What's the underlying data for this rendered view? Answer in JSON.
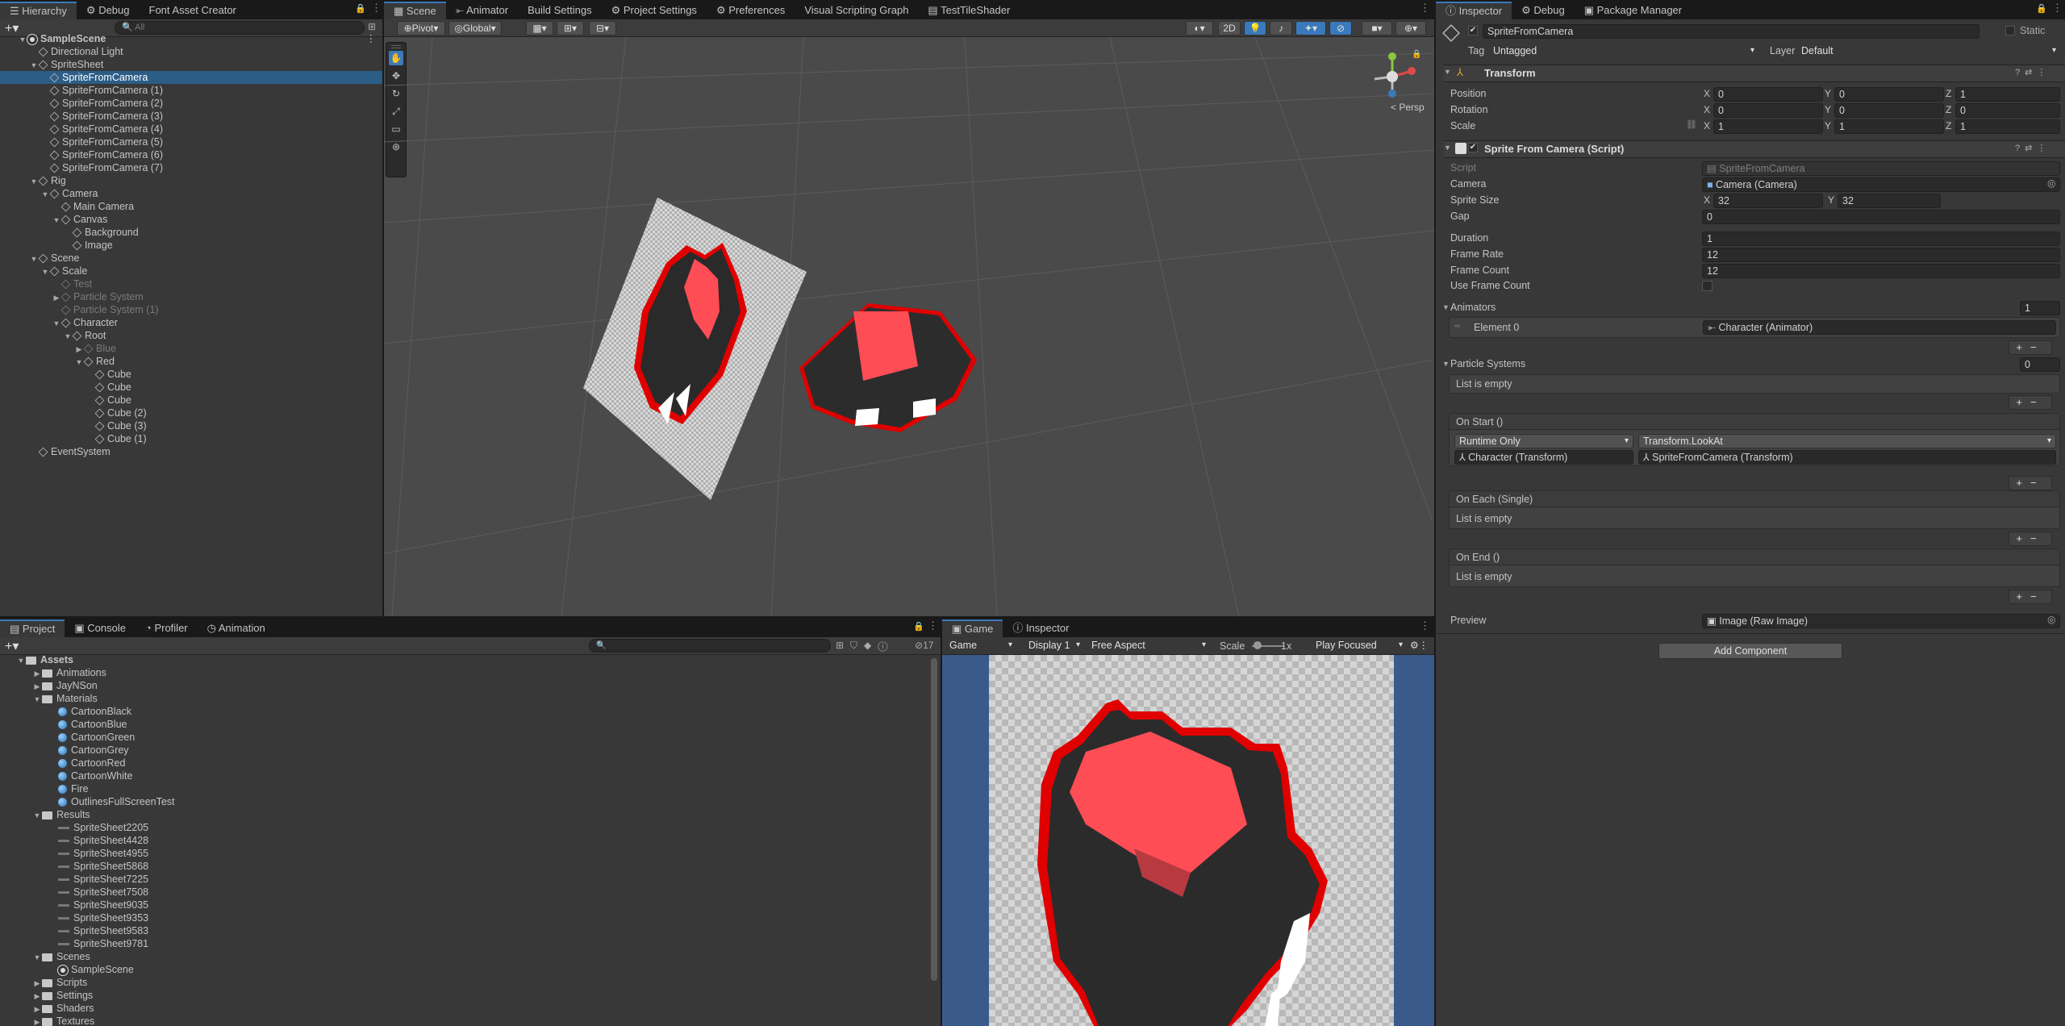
{
  "hierarchy": {
    "tabs": [
      "Hierarchy",
      "Debug",
      "Font Asset Creator"
    ],
    "search_placeholder": "All",
    "rows": [
      {
        "label": "SampleScene",
        "depth": 0,
        "arrow": "▼",
        "icon": "unity-scene-icon",
        "bold": true
      },
      {
        "label": "Directional Light",
        "depth": 1,
        "arrow": ""
      },
      {
        "label": "SpriteSheet",
        "depth": 1,
        "arrow": "▼"
      },
      {
        "label": "SpriteFromCamera",
        "depth": 2,
        "arrow": "",
        "selected": true
      },
      {
        "label": "SpriteFromCamera (1)",
        "depth": 2,
        "arrow": ""
      },
      {
        "label": "SpriteFromCamera (2)",
        "depth": 2,
        "arrow": ""
      },
      {
        "label": "SpriteFromCamera (3)",
        "depth": 2,
        "arrow": ""
      },
      {
        "label": "SpriteFromCamera (4)",
        "depth": 2,
        "arrow": ""
      },
      {
        "label": "SpriteFromCamera (5)",
        "depth": 2,
        "arrow": ""
      },
      {
        "label": "SpriteFromCamera (6)",
        "depth": 2,
        "arrow": ""
      },
      {
        "label": "SpriteFromCamera (7)",
        "depth": 2,
        "arrow": ""
      },
      {
        "label": "Rig",
        "depth": 1,
        "arrow": "▼"
      },
      {
        "label": "Camera",
        "depth": 2,
        "arrow": "▼"
      },
      {
        "label": "Main Camera",
        "depth": 3,
        "arrow": ""
      },
      {
        "label": "Canvas",
        "depth": 3,
        "arrow": "▼"
      },
      {
        "label": "Background",
        "depth": 4,
        "arrow": ""
      },
      {
        "label": "Image",
        "depth": 4,
        "arrow": ""
      },
      {
        "label": "Scene",
        "depth": 1,
        "arrow": "▼"
      },
      {
        "label": "Scale",
        "depth": 2,
        "arrow": "▼"
      },
      {
        "label": "Test",
        "depth": 3,
        "arrow": "",
        "dim": true
      },
      {
        "label": "Particle System",
        "depth": 3,
        "arrow": "▶",
        "dim": true
      },
      {
        "label": "Particle System (1)",
        "depth": 3,
        "arrow": "",
        "dim": true
      },
      {
        "label": "Character",
        "depth": 3,
        "arrow": "▼"
      },
      {
        "label": "Root",
        "depth": 4,
        "arrow": "▼"
      },
      {
        "label": "Blue",
        "depth": 5,
        "arrow": "▶",
        "dim": true
      },
      {
        "label": "Red",
        "depth": 5,
        "arrow": "▼"
      },
      {
        "label": "Cube",
        "depth": 6,
        "arrow": ""
      },
      {
        "label": "Cube",
        "depth": 6,
        "arrow": ""
      },
      {
        "label": "Cube",
        "depth": 6,
        "arrow": ""
      },
      {
        "label": "Cube (2)",
        "depth": 6,
        "arrow": ""
      },
      {
        "label": "Cube (3)",
        "depth": 6,
        "arrow": ""
      },
      {
        "label": "Cube (1)",
        "depth": 6,
        "arrow": ""
      },
      {
        "label": "EventSystem",
        "depth": 1,
        "arrow": ""
      }
    ]
  },
  "scene": {
    "tabs": [
      "Scene",
      "Animator",
      "Build Settings",
      "Project Settings",
      "Preferences",
      "Visual Scripting Graph",
      "TestTileShader"
    ],
    "pivot": "Pivot",
    "global": "Global",
    "mode_2d": "2D",
    "persp": "< Persp"
  },
  "project": {
    "tabs": [
      "Project",
      "Console",
      "Profiler",
      "Animation"
    ],
    "count": "17",
    "rows": [
      {
        "label": "Assets",
        "depth": 0,
        "arrow": "▼",
        "icon": "folder",
        "bold": true
      },
      {
        "label": "Animations",
        "depth": 1,
        "arrow": "▶",
        "icon": "folder"
      },
      {
        "label": "JayNSon",
        "depth": 1,
        "arrow": "▶",
        "icon": "folder"
      },
      {
        "label": "Materials",
        "depth": 1,
        "arrow": "▼",
        "icon": "folder"
      },
      {
        "label": "CartoonBlack",
        "depth": 2,
        "arrow": "",
        "icon": "material"
      },
      {
        "label": "CartoonBlue",
        "depth": 2,
        "arrow": "",
        "icon": "material"
      },
      {
        "label": "CartoonGreen",
        "depth": 2,
        "arrow": "",
        "icon": "material"
      },
      {
        "label": "CartoonGrey",
        "depth": 2,
        "arrow": "",
        "icon": "material"
      },
      {
        "label": "CartoonRed",
        "depth": 2,
        "arrow": "",
        "icon": "material"
      },
      {
        "label": "CartoonWhite",
        "depth": 2,
        "arrow": "",
        "icon": "material"
      },
      {
        "label": "Fire",
        "depth": 2,
        "arrow": "",
        "icon": "material"
      },
      {
        "label": "OutlinesFullScreenTest",
        "depth": 2,
        "arrow": "",
        "icon": "material"
      },
      {
        "label": "Results",
        "depth": 1,
        "arrow": "▼",
        "icon": "folder"
      },
      {
        "label": "SpriteSheet2205",
        "depth": 2,
        "arrow": "",
        "icon": "sheet"
      },
      {
        "label": "SpriteSheet4428",
        "depth": 2,
        "arrow": "",
        "icon": "sheet"
      },
      {
        "label": "SpriteSheet4955",
        "depth": 2,
        "arrow": "",
        "icon": "sheet"
      },
      {
        "label": "SpriteSheet5868",
        "depth": 2,
        "arrow": "",
        "icon": "sheet"
      },
      {
        "label": "SpriteSheet7225",
        "depth": 2,
        "arrow": "",
        "icon": "sheet"
      },
      {
        "label": "SpriteSheet7508",
        "depth": 2,
        "arrow": "",
        "icon": "sheet"
      },
      {
        "label": "SpriteSheet9035",
        "depth": 2,
        "arrow": "",
        "icon": "sheet"
      },
      {
        "label": "SpriteSheet9353",
        "depth": 2,
        "arrow": "",
        "icon": "sheet"
      },
      {
        "label": "SpriteSheet9583",
        "depth": 2,
        "arrow": "",
        "icon": "sheet"
      },
      {
        "label": "SpriteSheet9781",
        "depth": 2,
        "arrow": "",
        "icon": "sheet"
      },
      {
        "label": "Scenes",
        "depth": 1,
        "arrow": "▼",
        "icon": "folder"
      },
      {
        "label": "SampleScene",
        "depth": 2,
        "arrow": "",
        "icon": "unity"
      },
      {
        "label": "Scripts",
        "depth": 1,
        "arrow": "▶",
        "icon": "folder"
      },
      {
        "label": "Settings",
        "depth": 1,
        "arrow": "▶",
        "icon": "folder"
      },
      {
        "label": "Shaders",
        "depth": 1,
        "arrow": "▶",
        "icon": "folder"
      },
      {
        "label": "Textures",
        "depth": 1,
        "arrow": "▶",
        "icon": "folder"
      }
    ]
  },
  "game": {
    "tabs": [
      "Game",
      "Inspector"
    ],
    "mode": "Game",
    "display": "Display 1",
    "aspect": "Free Aspect",
    "scale_label": "Scale",
    "scale_value": "1x",
    "play_mode": "Play Focused"
  },
  "inspector": {
    "tabs": [
      "Inspector",
      "Debug",
      "Package Manager"
    ],
    "object_name": "SpriteFromCamera",
    "static_label": "Static",
    "tag_label": "Tag",
    "tag_value": "Untagged",
    "layer_label": "Layer",
    "layer_value": "Default",
    "transform": {
      "title": "Transform",
      "position_label": "Position",
      "rotation_label": "Rotation",
      "scale_label": "Scale",
      "position": [
        "0",
        "0",
        "1"
      ],
      "rotation": [
        "0",
        "0",
        "0"
      ],
      "scale": [
        "1",
        "1",
        "1"
      ]
    },
    "sprite": {
      "title": "Sprite From Camera (Script)",
      "script_label": "Script",
      "script_value": "SpriteFromCamera",
      "camera_label": "Camera",
      "camera_value": "Camera (Camera)",
      "sprite_size_label": "Sprite Size",
      "sprite_size_x": "32",
      "sprite_size_y": "32",
      "gap_label": "Gap",
      "gap_value": "0",
      "duration_label": "Duration",
      "duration_value": "1",
      "frame_rate_label": "Frame Rate",
      "frame_rate_value": "12",
      "frame_count_label": "Frame Count",
      "frame_count_value": "12",
      "use_frame_count_label": "Use Frame Count",
      "animators_label": "Animators",
      "animators_count": "1",
      "element0_label": "Element 0",
      "element0_value": "Character (Animator)",
      "particle_label": "Particle Systems",
      "particle_count": "0",
      "list_empty": "List is empty",
      "on_start": "On Start ()",
      "runtime_only": "Runtime Only",
      "method": "Transform.LookAt",
      "target": "Character (Transform)",
      "argument": "SpriteFromCamera (Transform)",
      "on_each": "On Each (Single)",
      "on_end": "On End ()",
      "preview_label": "Preview",
      "preview_value": "Image (Raw Image)"
    },
    "add_component": "Add Component"
  },
  "colors": {
    "selection": "#2c5d87",
    "accent_red": "#ff4d55",
    "outline_red": "#e00000",
    "game_bg": "#3a5a8c"
  }
}
